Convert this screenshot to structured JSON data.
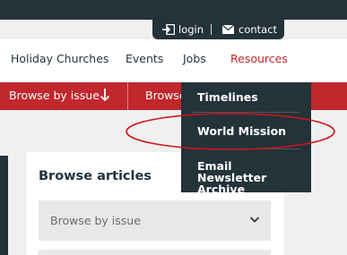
{
  "utility_bar": {
    "login_label": "login",
    "contact_label": "contact",
    "login_icon": "login-arrow-icon",
    "contact_icon": "envelope-icon"
  },
  "nav": {
    "items": [
      {
        "label": "Holiday Churches"
      },
      {
        "label": "Events"
      },
      {
        "label": "Jobs"
      },
      {
        "label": "Resources",
        "active": true
      }
    ]
  },
  "browse_bar": {
    "browse_by_issue": "Browse by issue",
    "browse_partial": "Browse",
    "arrow_icon": "arrow-down-icon"
  },
  "resources_menu": {
    "items": [
      {
        "label": "Timelines"
      },
      {
        "label": "World Mission"
      },
      {
        "label": "Email Newsletter Archive"
      }
    ],
    "highlighted_item": "World Mission"
  },
  "browse_articles": {
    "title": "Browse articles",
    "select_value": "Browse by issue",
    "chevron_icon": "chevron-down-icon"
  },
  "colors": {
    "dark": "#24323a",
    "accent_red": "#c1272d",
    "background": "#f0f0f0",
    "annotation_red": "#d0141c"
  }
}
